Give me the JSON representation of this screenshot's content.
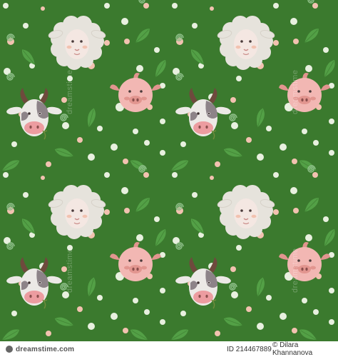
{
  "colors": {
    "background": "#3b7a2e",
    "leaf": "#53a046",
    "dot_white": "#e8f0df",
    "dot_pink": "#f2c2b0",
    "spiral": "#8fc08a",
    "sheep_wool": "#e6e3dc",
    "sheep_face": "#f4e7e2",
    "pig": "#f2b7b3",
    "pig_dark": "#e2958f",
    "cow_white": "#ece9e6",
    "cow_spot": "#8d8388",
    "cow_nose": "#ec9ca0",
    "horn": "#6e4a3d"
  },
  "pattern": {
    "animals": [
      "sheep",
      "pig",
      "cow"
    ],
    "tile": {
      "columns": 2,
      "rows": 2
    }
  },
  "watermark": {
    "brand": "dreamstime"
  },
  "footer": {
    "logo_text": "dreamstime.com",
    "id_text": "ID 214467889",
    "author_text": "© Dilara Khannanova"
  }
}
